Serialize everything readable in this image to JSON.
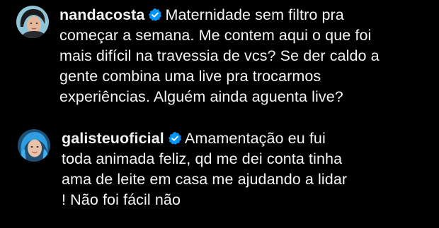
{
  "comments": [
    {
      "username": "nandacosta",
      "verified": true,
      "avatar_icon": "avatar-nandacosta-photo",
      "text_lines": [
        "Maternidade sem filtro pra",
        "começar a semana. Me contem aqui o que foi",
        "mais difícil na travessia de vcs? Se der caldo a",
        "gente combina uma live pra trocarmos",
        "experiências. Alguém ainda aguenta live?"
      ]
    },
    {
      "username": "galisteuoficial",
      "verified": true,
      "avatar_icon": "avatar-galisteuoficial-photo",
      "text_lines": [
        "Amamentação eu fui",
        "toda animada feliz, qd me dei conta tinha",
        "ama de leite em casa me ajudando a lidar",
        "! Não foi fácil não"
      ]
    }
  ],
  "colors": {
    "background": "#000000",
    "text": "#f5f5f5",
    "verified_badge": "#0095f6"
  }
}
